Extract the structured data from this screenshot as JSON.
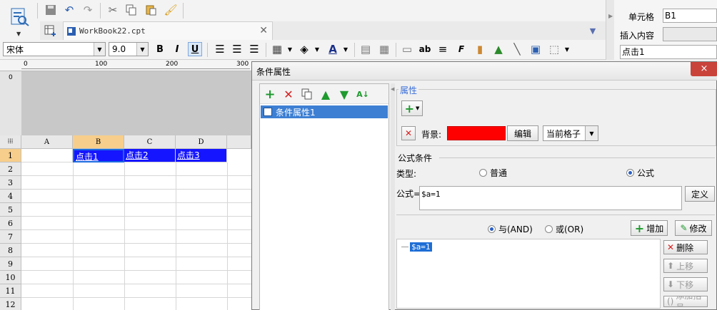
{
  "toolbar": {
    "file_tab_name": "WorkBook22.cpt",
    "font_name": "宋体",
    "font_size": "9.0"
  },
  "side_panel": {
    "cell_label": "单元格",
    "cell_value": "B1",
    "insert_label": "插入内容",
    "insert_value": "",
    "content_value": "点击1"
  },
  "sheet": {
    "ruler_marks": [
      "0",
      "100",
      "200",
      "300"
    ],
    "columns": [
      "A",
      "B",
      "C",
      "D"
    ],
    "rows": [
      "1",
      "2",
      "3",
      "4",
      "5",
      "6",
      "7",
      "8",
      "9",
      "10",
      "11",
      "12"
    ],
    "cells": {
      "B1": "点击1",
      "C1": "点击2",
      "D1": "点击3"
    }
  },
  "dialog": {
    "title": "条件属性",
    "close": "×",
    "list_item": "条件属性1",
    "props_title": "属性",
    "bg_label": "背景:",
    "edit_button": "编辑",
    "scope_value": "当前格子",
    "formula_section": "公式条件",
    "type_label": "类型:",
    "type_normal": "普通",
    "type_formula": "公式",
    "formula_label": "公式=",
    "formula_value": "$a=1",
    "define_button": "定义",
    "and_label": "与(AND)",
    "or_label": "或(OR)",
    "add_button": "增加",
    "modify_button": "修改",
    "tree_node": "$a=1",
    "delete_button": "删除",
    "up_button": "上移",
    "down_button": "下移",
    "bracket_button": "添加括号"
  },
  "colors": {
    "link_cell_bg": "#1515ff",
    "selected_header": "#f7ce8b",
    "bg_swatch": "#ff0000",
    "selection": "#3d7fd3"
  }
}
